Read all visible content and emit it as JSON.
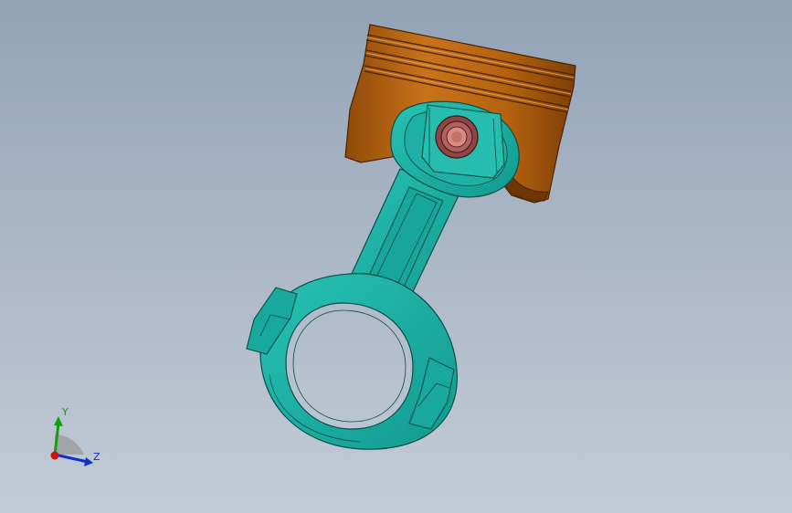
{
  "viewport": {
    "background_top": "#92a3b6",
    "background_bottom": "#c3cbd7"
  },
  "model": {
    "piston": {
      "name": "piston",
      "color": "#b8650f"
    },
    "connecting_rod": {
      "name": "connecting-rod",
      "color": "#1fb3a6"
    },
    "wrist_pin": {
      "name": "wrist-pin",
      "color": "#a0504e"
    }
  },
  "triad": {
    "y_label": "Y",
    "z_label": "Z",
    "x_color": "#d01010",
    "y_color": "#12a012",
    "z_color": "#1030c8"
  }
}
